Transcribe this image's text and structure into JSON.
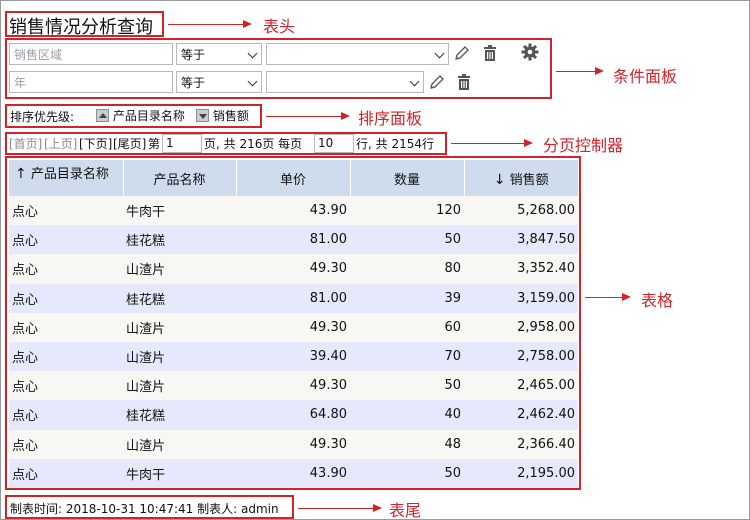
{
  "header": {
    "title": "销售情况分析查询"
  },
  "annotations": {
    "header": "表头",
    "conditions": "条件面板",
    "sort": "排序面板",
    "pager": "分页控制器",
    "table": "表格",
    "footer": "表尾"
  },
  "conditions": [
    {
      "field_placeholder": "销售区域",
      "operator": "等于",
      "value": ""
    },
    {
      "field_placeholder": "年",
      "operator": "等于",
      "value": ""
    }
  ],
  "icons": {
    "edit": "pencil-icon",
    "delete": "trash-icon",
    "settings": "gear-icon"
  },
  "sort": {
    "label": "排序优先级:",
    "items": [
      {
        "label": "产品目录名称",
        "direction": "asc"
      },
      {
        "label": "销售额",
        "direction": "desc"
      }
    ]
  },
  "pager": {
    "first": "[首页]",
    "prev": "[上页]",
    "next": "[下页]",
    "last": "[尾页]",
    "page_prefix": "第",
    "page_value": "1",
    "page_suffix": "页, 共 216页 每页",
    "size_value": "10",
    "size_suffix": "行, 共 2154行"
  },
  "table": {
    "columns": [
      "产品目录名称",
      "产品名称",
      "单价",
      "数量",
      "销售额"
    ],
    "rows": [
      [
        "点心",
        "牛肉干",
        "43.90",
        "120",
        "5,268.00"
      ],
      [
        "点心",
        "桂花糕",
        "81.00",
        "50",
        "3,847.50"
      ],
      [
        "点心",
        "山渣片",
        "49.30",
        "80",
        "3,352.40"
      ],
      [
        "点心",
        "桂花糕",
        "81.00",
        "39",
        "3,159.00"
      ],
      [
        "点心",
        "山渣片",
        "49.30",
        "60",
        "2,958.00"
      ],
      [
        "点心",
        "山渣片",
        "39.40",
        "70",
        "2,758.00"
      ],
      [
        "点心",
        "山渣片",
        "49.30",
        "50",
        "2,465.00"
      ],
      [
        "点心",
        "桂花糕",
        "64.80",
        "40",
        "2,462.40"
      ],
      [
        "点心",
        "山渣片",
        "49.30",
        "48",
        "2,366.40"
      ],
      [
        "点心",
        "牛肉干",
        "43.90",
        "50",
        "2,195.00"
      ]
    ]
  },
  "footer": {
    "text": "制表时间: 2018-10-31 10:47:41 制表人: admin"
  },
  "colors": {
    "annotation": "#d0232a",
    "header_bg": "#cfdcee",
    "row_odd": "#f9f7f3",
    "row_even": "#e5e9fb"
  }
}
